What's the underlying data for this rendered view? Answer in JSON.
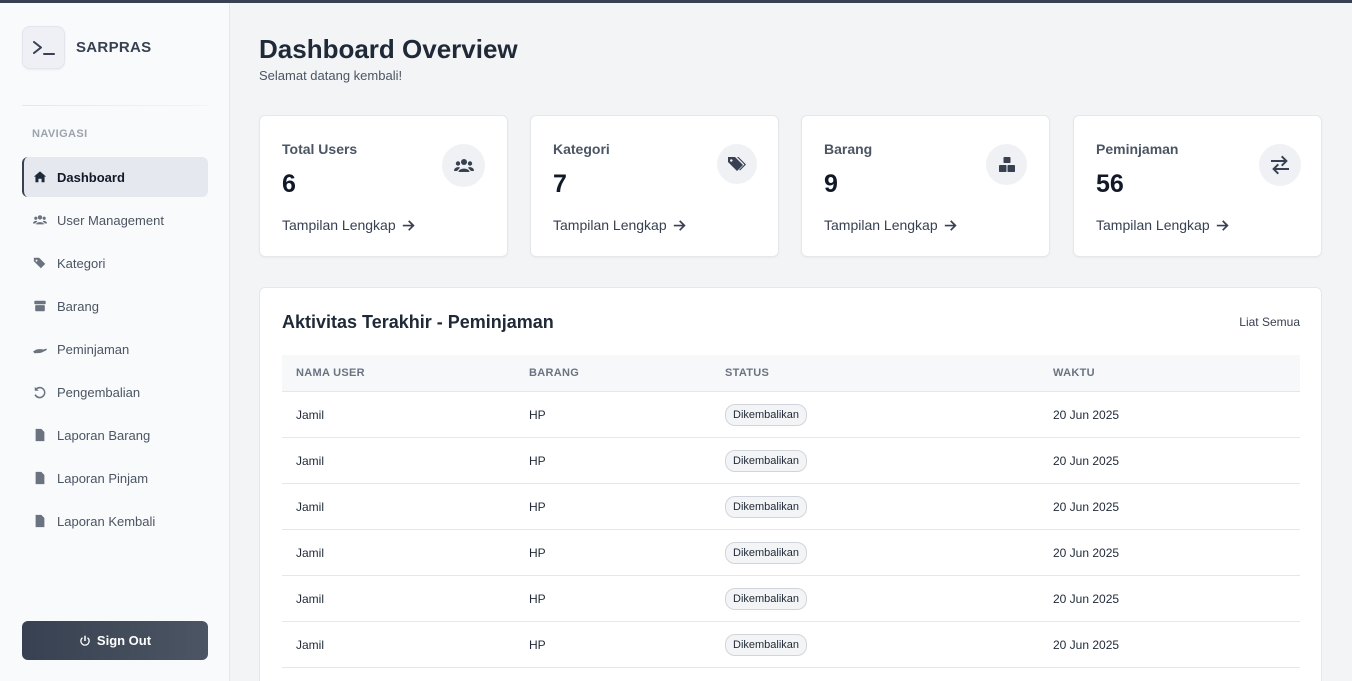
{
  "brand": {
    "name": "SARPRAS",
    "logo_icon": "terminal-icon"
  },
  "sidebar": {
    "heading": "NAVIGASI",
    "items": [
      {
        "label": "Dashboard",
        "icon": "home-icon",
        "active": true
      },
      {
        "label": "User Management",
        "icon": "users-icon",
        "active": false
      },
      {
        "label": "Kategori",
        "icon": "tags-icon",
        "active": false
      },
      {
        "label": "Barang",
        "icon": "box-icon",
        "active": false
      },
      {
        "label": "Peminjaman",
        "icon": "hand-icon",
        "active": false
      },
      {
        "label": "Pengembalian",
        "icon": "undo-icon",
        "active": false
      },
      {
        "label": "Laporan Barang",
        "icon": "file-icon",
        "active": false
      },
      {
        "label": "Laporan Pinjam",
        "icon": "file-icon",
        "active": false
      },
      {
        "label": "Laporan Kembali",
        "icon": "file-icon",
        "active": false
      }
    ],
    "signout_label": "Sign Out"
  },
  "header": {
    "title": "Dashboard Overview",
    "subtitle": "Selamat datang kembali!"
  },
  "stats": [
    {
      "label": "Total Users",
      "value": "6",
      "link": "Tampilan Lengkap",
      "icon": "users-icon"
    },
    {
      "label": "Kategori",
      "value": "7",
      "link": "Tampilan Lengkap",
      "icon": "tags-icon"
    },
    {
      "label": "Barang",
      "value": "9",
      "link": "Tampilan Lengkap",
      "icon": "boxes-icon"
    },
    {
      "label": "Peminjaman",
      "value": "56",
      "link": "Tampilan Lengkap",
      "icon": "exchange-icon"
    }
  ],
  "activity": {
    "title": "Aktivitas Terakhir - Peminjaman",
    "view_all": "Liat Semua",
    "columns": [
      "NAMA USER",
      "BARANG",
      "STATUS",
      "WAKTU"
    ],
    "rows": [
      {
        "user": "Jamil",
        "item": "HP",
        "status": "Dikembalikan",
        "time": "20 Jun 2025"
      },
      {
        "user": "Jamil",
        "item": "HP",
        "status": "Dikembalikan",
        "time": "20 Jun 2025"
      },
      {
        "user": "Jamil",
        "item": "HP",
        "status": "Dikembalikan",
        "time": "20 Jun 2025"
      },
      {
        "user": "Jamil",
        "item": "HP",
        "status": "Dikembalikan",
        "time": "20 Jun 2025"
      },
      {
        "user": "Jamil",
        "item": "HP",
        "status": "Dikembalikan",
        "time": "20 Jun 2025"
      },
      {
        "user": "Jamil",
        "item": "HP",
        "status": "Dikembalikan",
        "time": "20 Jun 2025"
      }
    ]
  }
}
